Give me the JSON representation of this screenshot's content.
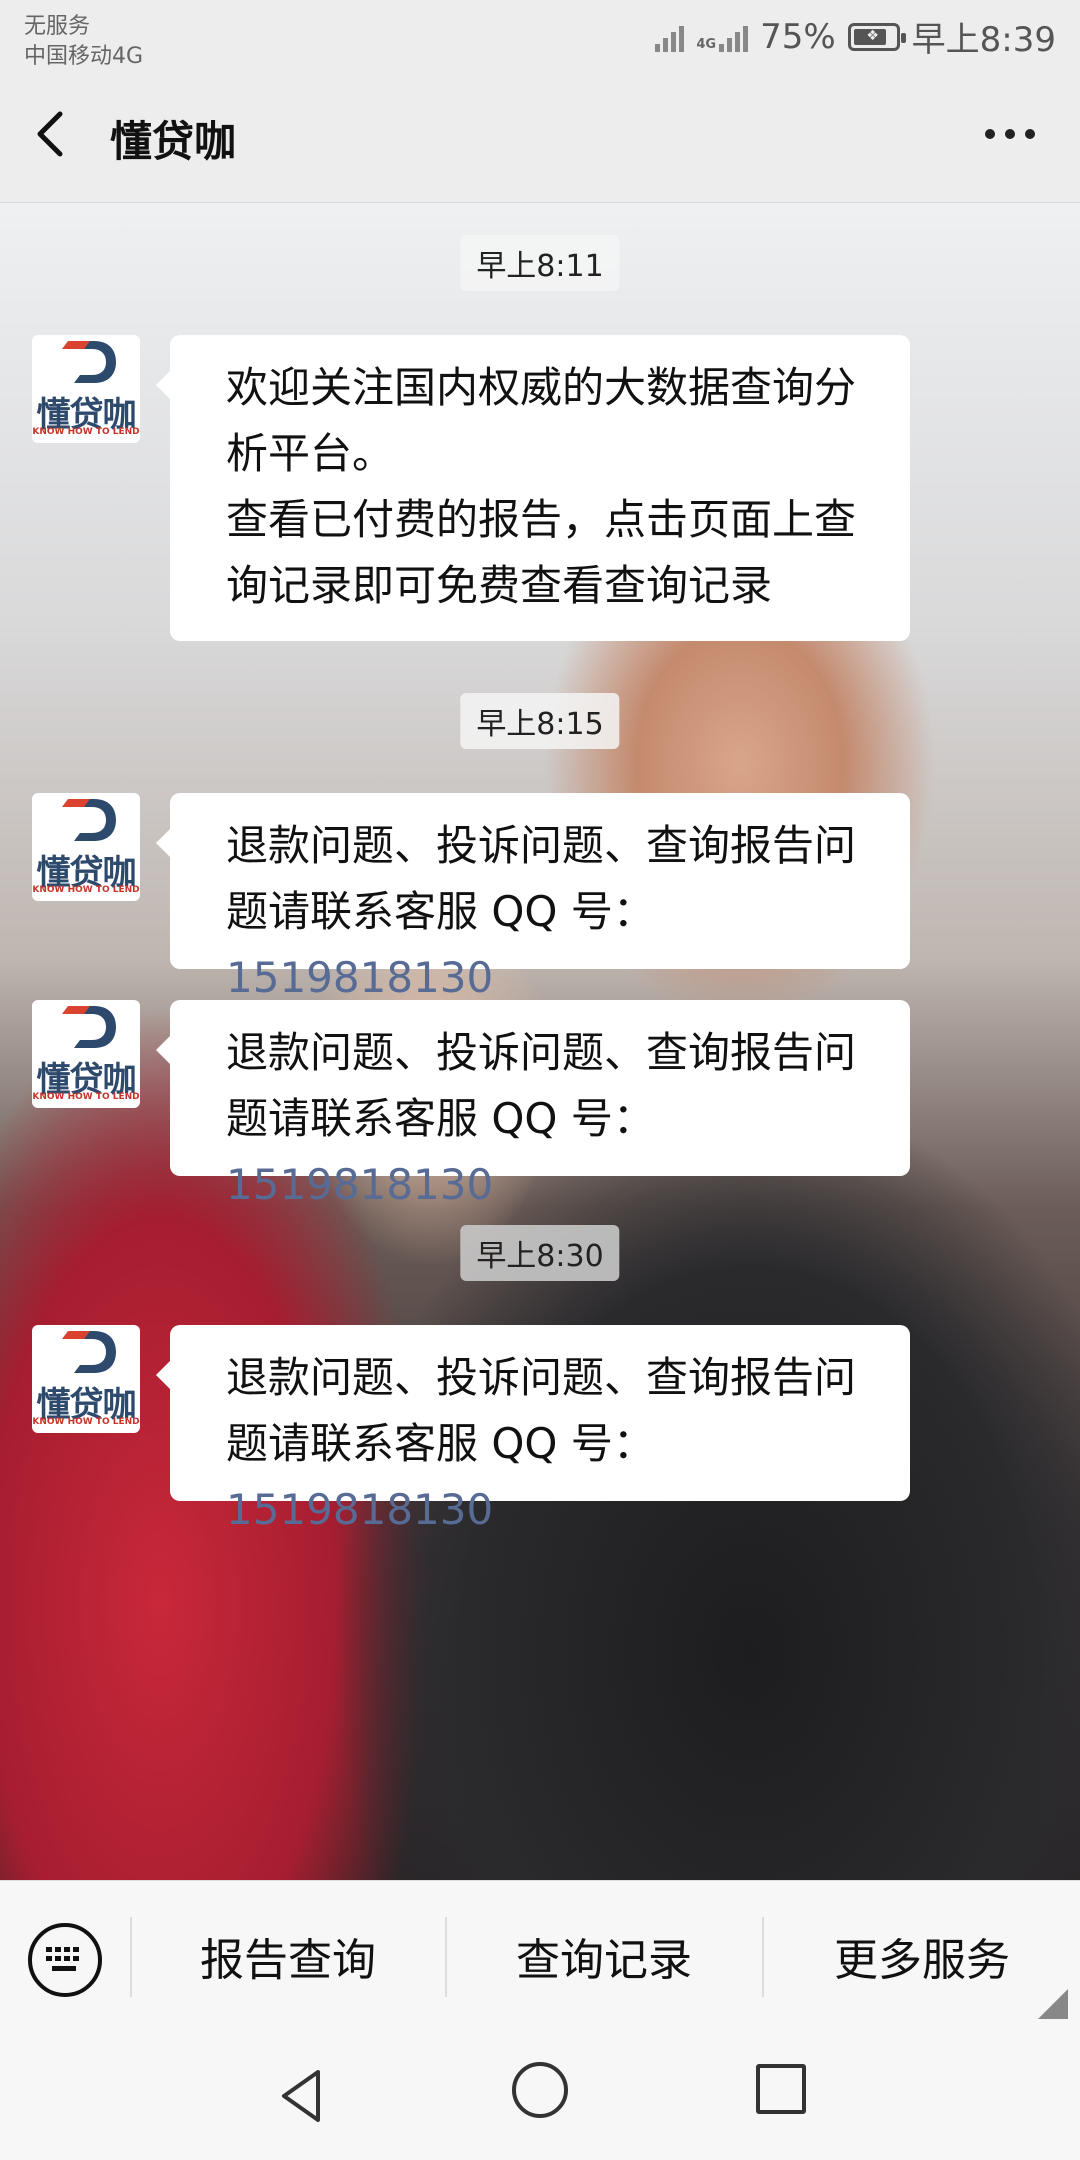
{
  "status_bar": {
    "carrier_line1": "无服务",
    "carrier_line2": "中国移动4G",
    "net_type": "4G",
    "battery": "75%",
    "time": "早上8:39"
  },
  "header": {
    "title": "懂贷咖"
  },
  "avatar": {
    "brand": "懂贷咖",
    "sub": "KNOW HOW TO LEND"
  },
  "messages": [
    {
      "time": "早上8:11",
      "lines": [
        "欢迎关注国内权威的大数据查询分",
        "析平台。",
        "查看已付费的报告，点击页面上查",
        "询记录即可免费查看查询记录"
      ]
    },
    {
      "time": "早上8:15",
      "line1": "退款问题、投诉问题、查询报告问",
      "line2_prefix": "题请联系客服 QQ 号：",
      "qq": "1519818130"
    },
    {
      "line1": "退款问题、投诉问题、查询报告问",
      "line2_prefix": "题请联系客服 QQ 号：",
      "qq": "1519818130"
    },
    {
      "time": "早上8:30",
      "line1": "退款问题、投诉问题、查询报告问",
      "line2_prefix": "题请联系客服 QQ 号：",
      "qq": "1519818130"
    }
  ],
  "menu": {
    "item1": "报告查询",
    "item2": "查询记录",
    "item3": "更多服务"
  },
  "colors": {
    "link": "#576b95",
    "brand_blue": "#2d4a6d",
    "brand_red": "#d9432f"
  }
}
